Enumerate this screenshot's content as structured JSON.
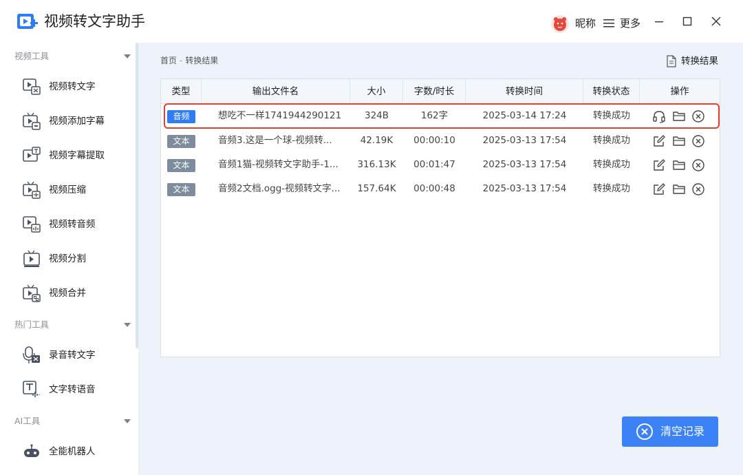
{
  "app": {
    "title": "视频转文字助手",
    "user_name": "昵称",
    "more_label": "更多"
  },
  "colors": {
    "accent": "#3b82f6",
    "audio_badge": "#2e7cf6",
    "text_badge": "#7f8c9d",
    "highlight": "#e0402f",
    "content_bg": "#eef3fb"
  },
  "sidebar": {
    "sections": [
      {
        "title": "视频工具",
        "items": [
          {
            "label": "视频转文字",
            "icon": "video-to-text-icon"
          },
          {
            "label": "视频添加字幕",
            "icon": "video-subtitle-add-icon"
          },
          {
            "label": "视频字幕提取",
            "icon": "video-subtitle-extract-icon"
          },
          {
            "label": "视频压缩",
            "icon": "video-compress-icon"
          },
          {
            "label": "视频转音频",
            "icon": "video-to-audio-icon"
          },
          {
            "label": "视频分割",
            "icon": "video-split-icon"
          },
          {
            "label": "视频合并",
            "icon": "video-merge-icon"
          }
        ]
      },
      {
        "title": "热门工具",
        "items": [
          {
            "label": "录音转文字",
            "icon": "recording-to-text-icon"
          },
          {
            "label": "文字转语音",
            "icon": "text-to-speech-icon"
          }
        ]
      },
      {
        "title": "AI工具",
        "items": [
          {
            "label": "全能机器人",
            "icon": "robot-icon"
          }
        ]
      }
    ]
  },
  "breadcrumb": {
    "home": "首页",
    "separator": "-",
    "current": "转换结果"
  },
  "result_button": "转换结果",
  "table": {
    "headers": [
      "类型",
      "输出文件名",
      "大小",
      "字数/时长",
      "转换时间",
      "转换状态",
      "操作"
    ],
    "rows": [
      {
        "type": "音频",
        "name": "想吃不一样1741944290121",
        "size": "324B",
        "length": "162字",
        "time": "2025-03-14 17:24",
        "status": "转换成功",
        "highlighted": true
      },
      {
        "type": "文本",
        "name": "音频3.这是一个球-视频转...",
        "size": "42.19K",
        "length": "00:00:10",
        "time": "2025-03-13 17:54",
        "status": "转换成功",
        "highlighted": false
      },
      {
        "type": "文本",
        "name": "音频1猫-视频转文字助手-1...",
        "size": "316.13K",
        "length": "00:01:47",
        "time": "2025-03-13 17:54",
        "status": "转换成功",
        "highlighted": false
      },
      {
        "type": "文本",
        "name": "音频2文档.ogg-视频转文字...",
        "size": "157.64K",
        "length": "00:00:48",
        "time": "2025-03-13 17:54",
        "status": "转换成功",
        "highlighted": false
      }
    ]
  },
  "clear_button": "清空记录"
}
